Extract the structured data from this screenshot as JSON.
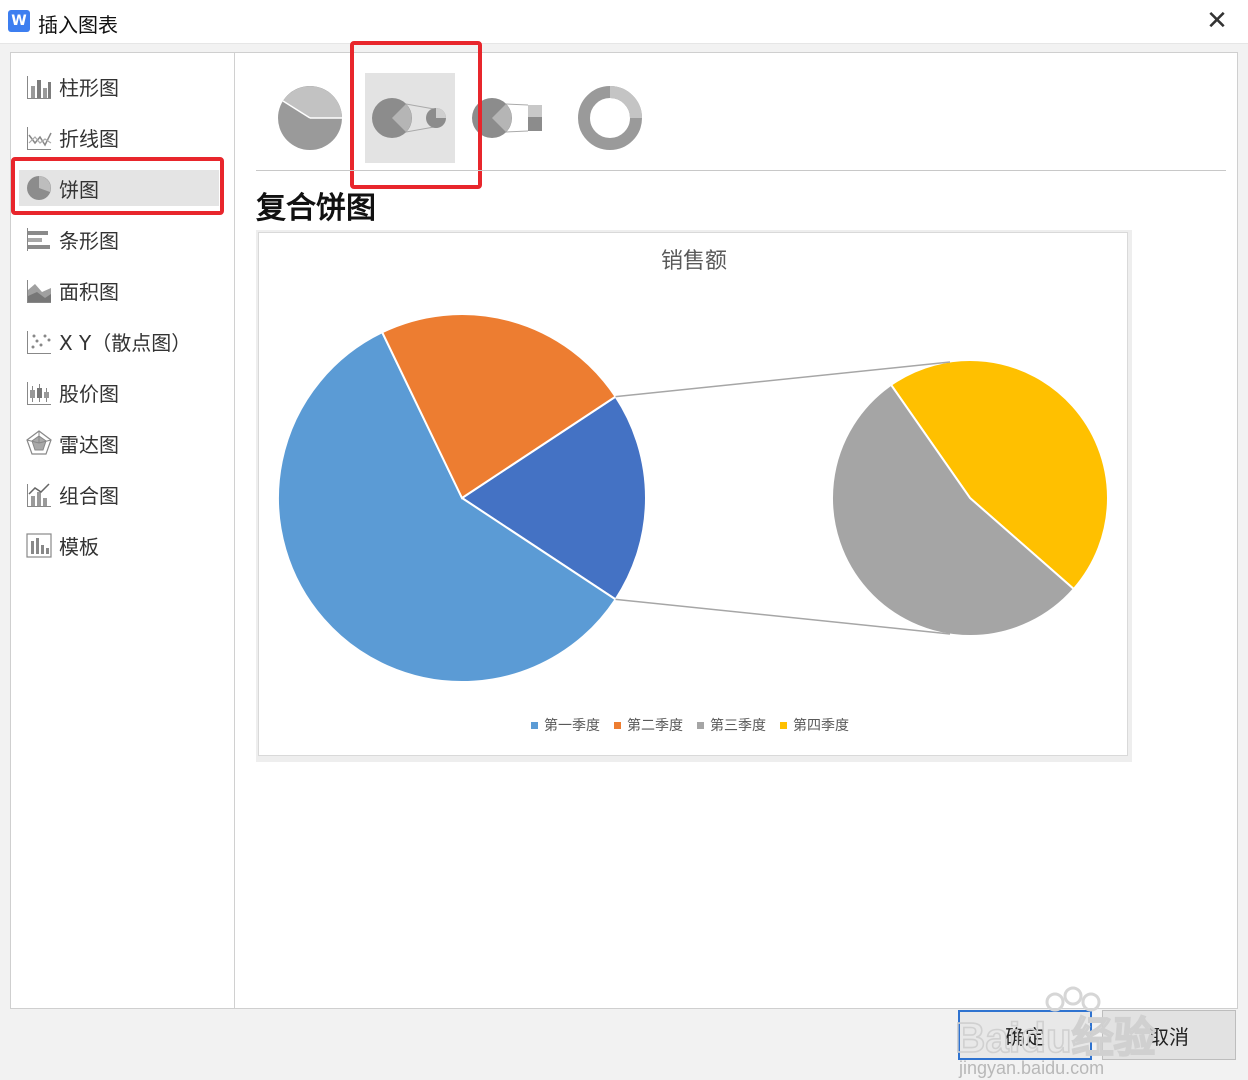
{
  "window": {
    "title": "插入图表",
    "app_icon": "wps-writer-icon",
    "close_glyph": "✕"
  },
  "sidebar": {
    "items": [
      {
        "label": "柱形图",
        "icon": "column-chart-icon"
      },
      {
        "label": "折线图",
        "icon": "line-chart-icon"
      },
      {
        "label": "饼图",
        "icon": "pie-chart-icon",
        "selected": true
      },
      {
        "label": "条形图",
        "icon": "bar-chart-icon"
      },
      {
        "label": "面积图",
        "icon": "area-chart-icon"
      },
      {
        "label": "X Y（散点图）",
        "icon": "scatter-chart-icon"
      },
      {
        "label": "股价图",
        "icon": "stock-chart-icon"
      },
      {
        "label": "雷达图",
        "icon": "radar-chart-icon"
      },
      {
        "label": "组合图",
        "icon": "combo-chart-icon"
      },
      {
        "label": "模板",
        "icon": "template-icon"
      }
    ]
  },
  "subtypes": [
    {
      "icon": "pie-icon"
    },
    {
      "icon": "pie-of-pie-icon",
      "selected": true
    },
    {
      "icon": "bar-of-pie-icon"
    },
    {
      "icon": "doughnut-icon"
    }
  ],
  "main": {
    "subtype_title": "复合饼图"
  },
  "chart_data": {
    "type": "pie",
    "subtype": "pie-of-pie",
    "title": "销售额",
    "categories": [
      "第一季度",
      "第二季度",
      "第三季度",
      "第四季度"
    ],
    "values": [
      8.2,
      3.2,
      1.4,
      1.2
    ],
    "main_pie_other_label": "",
    "secondary_categories": [
      "第三季度",
      "第四季度"
    ],
    "colors": [
      "#5b9bd5",
      "#ed7d31",
      "#a5a5a5",
      "#ffc000"
    ],
    "other_color": "#4472c4",
    "connector_color": "#a6a6a6",
    "legend_position": "bottom"
  },
  "buttons": {
    "ok": "确定",
    "cancel": "取消"
  },
  "watermark": {
    "text": "Baidu经验",
    "url_text": "jingyan.baidu.com"
  }
}
